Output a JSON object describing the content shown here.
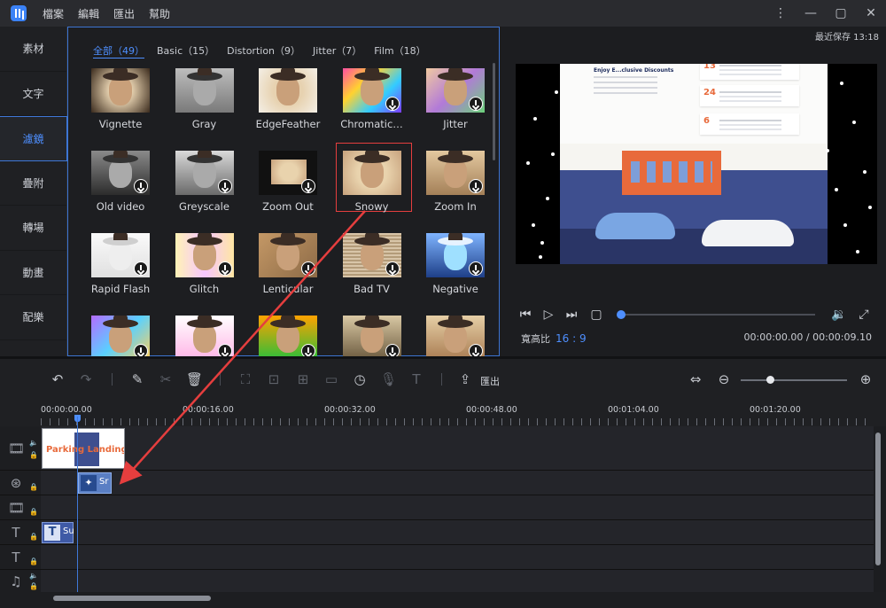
{
  "menu": [
    "檔案",
    "編輯",
    "匯出",
    "幫助"
  ],
  "window_controls": {
    "more": "⋮",
    "minimize": "—",
    "maximize": "▢",
    "close": "✕"
  },
  "sidebar": [
    "素材",
    "文字",
    "濾鏡",
    "疊附",
    "轉場",
    "動畫",
    "配樂"
  ],
  "sidebar_active": 2,
  "filter_tabs": [
    "全部（49）",
    "Basic（15）",
    "Distortion（9）",
    "Jitter（7）",
    "Film（18）"
  ],
  "filter_tab_active": 0,
  "filters": [
    {
      "label": "Vignette",
      "tone": "vignette",
      "download": false
    },
    {
      "label": "Gray",
      "tone": "gray",
      "download": false
    },
    {
      "label": "EdgeFeather",
      "tone": "edgefeather",
      "download": false
    },
    {
      "label": "Chromatic…",
      "tone": "chromatic",
      "download": true
    },
    {
      "label": "Jitter",
      "tone": "jitter",
      "download": true
    },
    {
      "label": "Old video",
      "tone": "oldvideo",
      "download": true
    },
    {
      "label": "Greyscale",
      "tone": "greyscale",
      "download": true
    },
    {
      "label": "Zoom Out",
      "tone": "zoomout",
      "download": true
    },
    {
      "label": "Snowy",
      "tone": "snowy",
      "download": false,
      "selected": true
    },
    {
      "label": "Zoom In",
      "tone": "zoomin",
      "download": true
    },
    {
      "label": "Rapid Flash",
      "tone": "rapidflash",
      "download": true
    },
    {
      "label": "Glitch",
      "tone": "glitch",
      "download": true
    },
    {
      "label": "Lenticular",
      "tone": "lenticular",
      "download": true
    },
    {
      "label": "Bad TV",
      "tone": "badtv",
      "download": true
    },
    {
      "label": "Negative",
      "tone": "negative",
      "download": true
    },
    {
      "label": "",
      "tone": "row4a",
      "download": true
    },
    {
      "label": "",
      "tone": "row4b",
      "download": true
    },
    {
      "label": "",
      "tone": "row4c",
      "download": true
    },
    {
      "label": "",
      "tone": "row4d",
      "download": true
    },
    {
      "label": "",
      "tone": "row4e",
      "download": true
    }
  ],
  "preview": {
    "autosave": "最近保存 13:18",
    "headline": "Enjoy E...clusive Discounts",
    "cards": [
      "13",
      "24",
      "6"
    ],
    "aspect_label": "寬高比",
    "aspect_value": "16 : 9",
    "timecode": "00:00:00.00 / 00:00:09.10",
    "progress": 0
  },
  "toolbar": {
    "export_label": "匯出"
  },
  "timeline": {
    "ruler": [
      "00:00:00.00",
      "00:00:16.00",
      "00:00:32.00",
      "00:00:48.00",
      "00:01:04.00",
      "00:01:20.00"
    ],
    "video_clip_text": "Parking Landing",
    "filter_clip_label": "Sr",
    "text_clip_label": "Su"
  },
  "colors": {
    "accent": "#4e8fff",
    "selection": "#e53e3e",
    "arrow": "#e53e3e"
  }
}
